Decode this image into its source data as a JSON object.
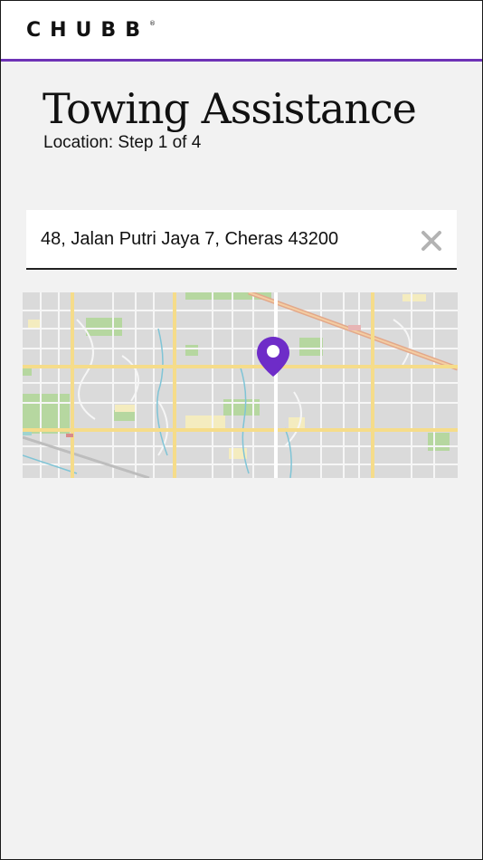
{
  "header": {
    "brand": "CHUBB",
    "trademark": "®"
  },
  "page": {
    "title": "Towing Assistance",
    "step_text": "Location: Step 1 of 4"
  },
  "location_input": {
    "value": "48, Jalan Putri Jaya 7, Cheras 43200",
    "clear_icon": "close-icon"
  },
  "map": {
    "marker_icon": "location-pin-icon",
    "colors": {
      "marker": "#6e2cc8",
      "road_major": "#f5dc8a",
      "park": "#b6d7a0",
      "block": "#d9d9d9"
    }
  },
  "colors": {
    "accent": "#6e33b6"
  }
}
